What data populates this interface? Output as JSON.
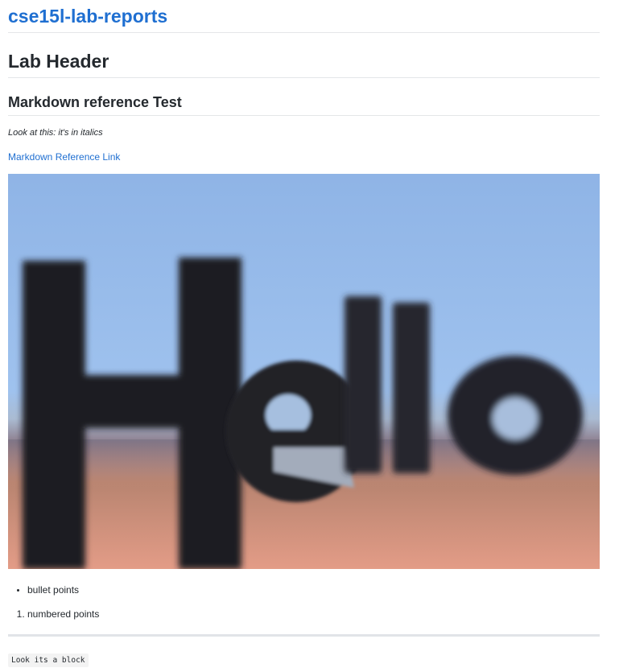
{
  "site": {
    "title": "cse15l-lab-reports"
  },
  "content": {
    "h1": "Lab Header",
    "h2": "Markdown reference Test",
    "italic_text": "Look at this: it's in italics",
    "link_text": "Markdown Reference Link",
    "image_text": "Hello",
    "bullet_items": [
      "bullet points"
    ],
    "numbered_items": [
      "numbered points"
    ],
    "code_text": "Look its a block"
  },
  "colors": {
    "link": "#1f6fd1",
    "text": "#24292e",
    "rule": "#e4e6e8"
  }
}
